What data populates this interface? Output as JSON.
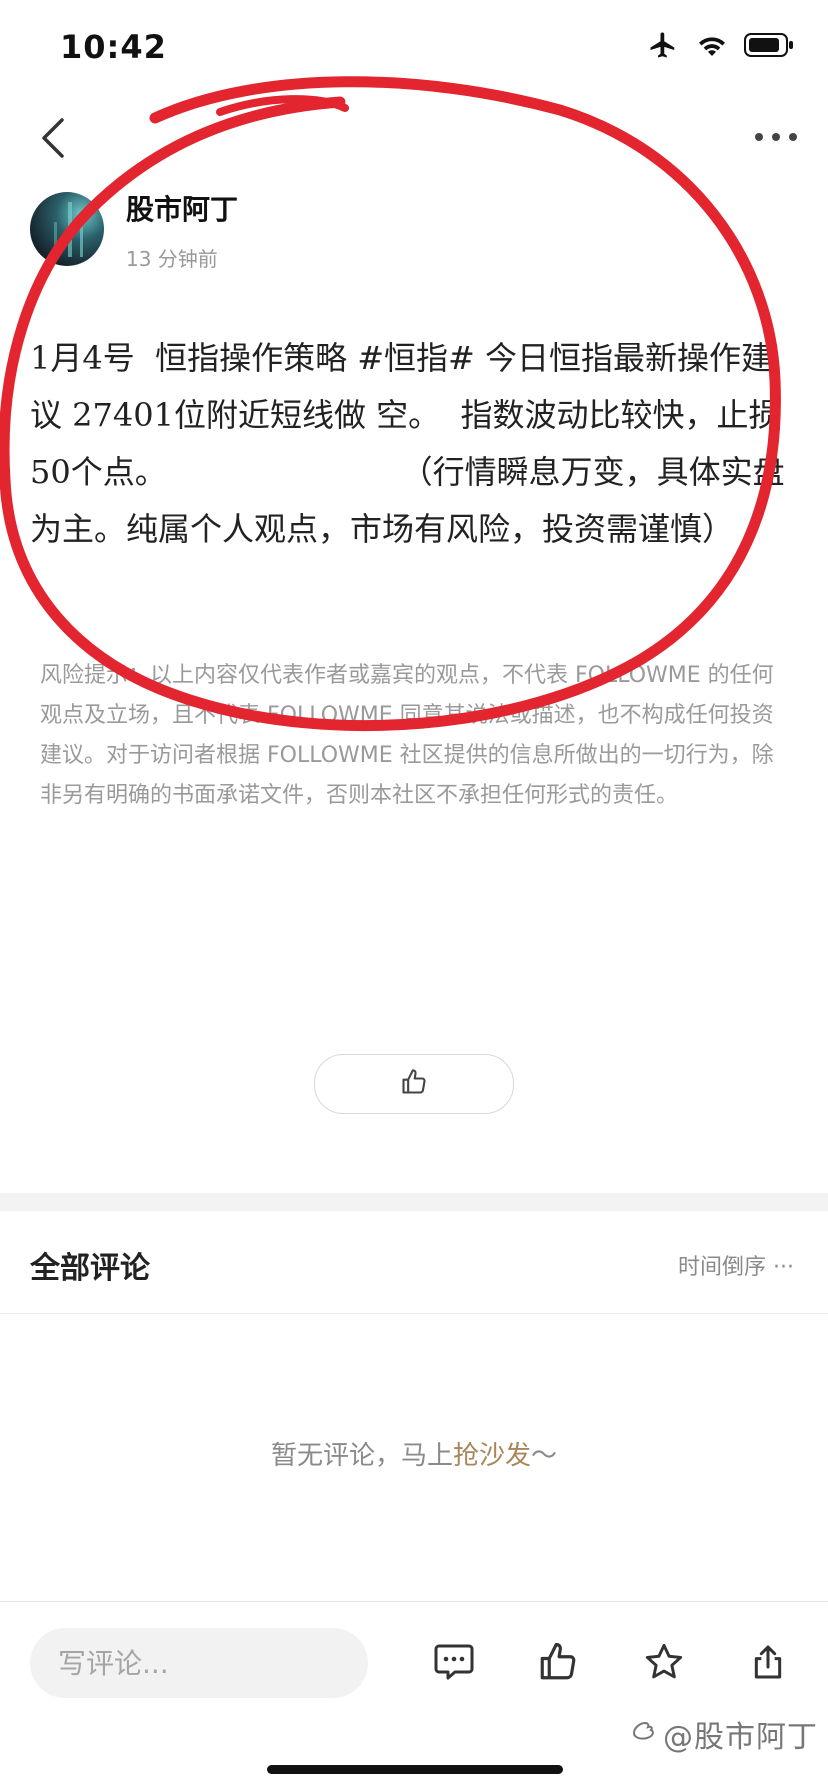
{
  "status_bar": {
    "time": "10:42",
    "icons": [
      "airplane-icon",
      "wifi-icon",
      "battery-icon"
    ]
  },
  "nav": {
    "back_icon": "chevron-left-icon",
    "more_icon": "more-dots-icon"
  },
  "post": {
    "author": "股市阿丁",
    "time_ago": "13 分钟前",
    "content": "1月4号  恒指操作策略 #恒指# 今日恒指最新操作建议 27401位附近短线做 空。  指数波动比较快，止损50个点。                       （行情瞬息万变，具体实盘为主。纯属个人观点，市场有风险，投资需谨慎）",
    "disclaimer": "风险提示：以上内容仅代表作者或嘉宾的观点，不代表 FOLLOWME 的任何观点及立场，且不代表 FOLLOWME 同意其说法或描述，也不构成任何投资建议。对于访问者根据 FOLLOWME 社区提供的信息所做出的一切行为，除非另有明确的书面承诺文件，否则本社区不承担任何形式的责任。"
  },
  "comments": {
    "title": "全部评论",
    "sort_label": "时间倒序 ···",
    "empty_prefix": "暂无评论，马上",
    "empty_link": "抢沙发",
    "empty_suffix": "～"
  },
  "bottom_bar": {
    "input_placeholder": "写评论...",
    "icons": [
      "comment-icon",
      "like-icon",
      "star-icon",
      "share-icon"
    ]
  },
  "watermark": "@股市阿丁",
  "colors": {
    "annotation": "#e2252f",
    "link": "#a8865a",
    "muted": "#9a9a9a"
  }
}
